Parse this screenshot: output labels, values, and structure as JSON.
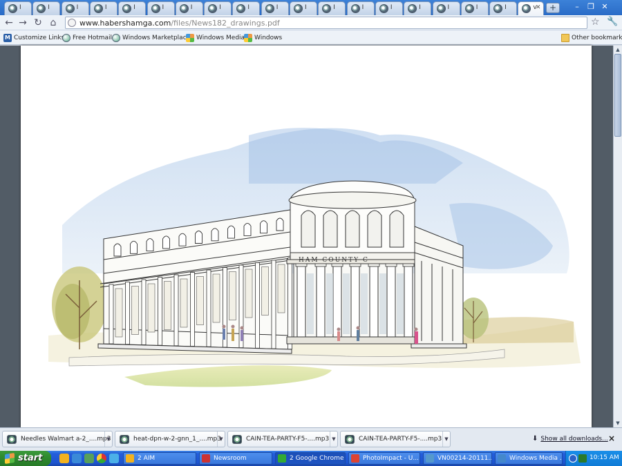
{
  "tabs": [
    {
      "label": "I",
      "active": false
    },
    {
      "label": "I",
      "active": false
    },
    {
      "label": "I",
      "active": false
    },
    {
      "label": "I",
      "active": false
    },
    {
      "label": "I",
      "active": false
    },
    {
      "label": "I",
      "active": false
    },
    {
      "label": "I",
      "active": false
    },
    {
      "label": "I",
      "active": false
    },
    {
      "label": "I",
      "active": false
    },
    {
      "label": "I",
      "active": false
    },
    {
      "label": "I",
      "active": false
    },
    {
      "label": "I",
      "active": false
    },
    {
      "label": "I",
      "active": false
    },
    {
      "label": "I",
      "active": false
    },
    {
      "label": "I",
      "active": false
    },
    {
      "label": "I",
      "active": false
    },
    {
      "label": "I",
      "active": false
    },
    {
      "label": "I",
      "active": false
    },
    {
      "label": "v",
      "active": true
    }
  ],
  "toolbar": {
    "url_domain": "www.habershamga.com",
    "url_path": "/files/News182_drawings.pdf"
  },
  "bookmarks": {
    "items": [
      {
        "label": "Customize Links",
        "icon": "msn-m-icon"
      },
      {
        "label": "Free Hotmail",
        "icon": "globe-icon"
      },
      {
        "label": "Windows Marketplace",
        "icon": "globe-icon"
      },
      {
        "label": "Windows Media",
        "icon": "windows-icon"
      },
      {
        "label": "Windows",
        "icon": "windows-icon"
      }
    ],
    "other": "Other bookmarks"
  },
  "pdf": {
    "sign_text": "HAM   COUNTY   C"
  },
  "downloads": {
    "items": [
      {
        "name": "Needles Walmart a-2_....mp3"
      },
      {
        "name": "heat-dpn-w-2-gnn_1_....mp3"
      },
      {
        "name": "CAIN-TEA-PARTY-F5-....mp3"
      },
      {
        "name": "CAIN-TEA-PARTY-F5-....mp3"
      }
    ],
    "show_all": "Show all downloads...",
    "close": "×"
  },
  "taskbar": {
    "start": "start",
    "buttons": [
      {
        "label": "2 AIM",
        "active": false
      },
      {
        "label": "Newsroom",
        "active": false
      },
      {
        "label": "2 Google Chrome",
        "active": true
      },
      {
        "label": "PhotoImpact - U...",
        "active": false
      },
      {
        "label": "VN00214-20111...",
        "active": false
      },
      {
        "label": "Windows Media ...",
        "active": false
      }
    ],
    "clock": "10:15 AM"
  },
  "colors": {
    "taskbar_blue": "#245edb",
    "start_green": "#2e8b2e",
    "tab_strip_blue": "#2a6cc7",
    "sky_blue": "#a8c4e6"
  }
}
